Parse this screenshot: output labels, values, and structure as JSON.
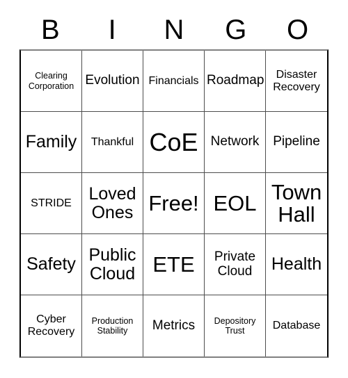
{
  "card": {
    "title": "BINGO",
    "header_letters": [
      "B",
      "I",
      "N",
      "G",
      "O"
    ],
    "grid_size": "5x5",
    "colors": {
      "background": "#ffffff",
      "text": "#000000",
      "grid_line": "#4d4d4d",
      "outer_border": "#000000"
    },
    "rows": [
      [
        {
          "label": "Clearing\nCorporation",
          "size": "xs",
          "free": false
        },
        {
          "label": "Evolution",
          "size": "m",
          "free": false
        },
        {
          "label": "Financials",
          "size": "s",
          "free": false
        },
        {
          "label": "Roadmap",
          "size": "m",
          "free": false
        },
        {
          "label": "Disaster\nRecovery",
          "size": "s",
          "free": false
        }
      ],
      [
        {
          "label": "Family",
          "size": "l",
          "free": false
        },
        {
          "label": "Thankful",
          "size": "s",
          "free": false
        },
        {
          "label": "CoE",
          "size": "xxl",
          "free": false
        },
        {
          "label": "Network",
          "size": "m",
          "free": false
        },
        {
          "label": "Pipeline",
          "size": "m",
          "free": false
        }
      ],
      [
        {
          "label": "STRIDE",
          "size": "s",
          "free": false
        },
        {
          "label": "Loved\nOnes",
          "size": "l",
          "free": false
        },
        {
          "label": "Free!",
          "size": "xl",
          "free": true
        },
        {
          "label": "EOL",
          "size": "xl",
          "free": false
        },
        {
          "label": "Town\nHall",
          "size": "xl",
          "free": false
        }
      ],
      [
        {
          "label": "Safety",
          "size": "l",
          "free": false
        },
        {
          "label": "Public\nCloud",
          "size": "l",
          "free": false
        },
        {
          "label": "ETE",
          "size": "xl",
          "free": false
        },
        {
          "label": "Private\nCloud",
          "size": "m",
          "free": false
        },
        {
          "label": "Health",
          "size": "l",
          "free": false
        }
      ],
      [
        {
          "label": "Cyber\nRecovery",
          "size": "s",
          "free": false
        },
        {
          "label": "Production\nStability",
          "size": "xs",
          "free": false
        },
        {
          "label": "Metrics",
          "size": "m",
          "free": false
        },
        {
          "label": "Depository\nTrust",
          "size": "xs",
          "free": false
        },
        {
          "label": "Database",
          "size": "s",
          "free": false
        }
      ]
    ]
  }
}
